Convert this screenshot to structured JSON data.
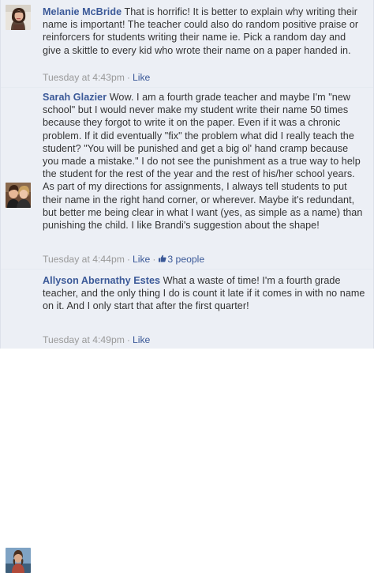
{
  "comments": [
    {
      "author": "Melanie McBride",
      "text": "That is horrific! It is better to explain why writing their name is important! The teacher could also do random positive praise or reinforcers for students writing their name ie. Pick a random day and give a skittle to every kid who wrote their name on a paper handed in.",
      "timestamp": "Tuesday at 4:43pm",
      "separator": "·",
      "like_label": "Like"
    },
    {
      "author": "Sarah Glazier",
      "text": "Wow. I am a fourth grade teacher and maybe I'm \"new school\" but I would never make my student write their name 50 times because they forgot to write it on the paper. Even if it was a chronic problem. If it did eventually \"fix\" the problem what did I really teach the student? \"You will be punished and get a big ol' hand cramp because you made a mistake.\" I do not see the punishment as a true way to help the student for the rest of the year and the rest of his/her school years. As part of my directions for assignments, I always tell students to put their name in the right hand corner, or wherever. Maybe it's redundant, but better me being clear in what I want (yes, as simple as a name) than punishing the child. I like Brandi's suggestion about the shape!",
      "timestamp": "Tuesday at 4:44pm",
      "separator": "·",
      "like_label": "Like",
      "likes_count": "3 people",
      "thumb_icon": "thumbs-up"
    },
    {
      "author": "Allyson Abernathy Estes",
      "text": "What a waste of time! I'm a fourth grade teacher, and the only thing I do is count it late if it comes in with no name on it. And I only start that after the first quarter!",
      "timestamp": "Tuesday at 4:49pm",
      "separator": "·",
      "like_label": "Like"
    }
  ],
  "colors": {
    "background": "#eceff5",
    "link": "#3b5998",
    "text": "#333333",
    "meta": "#999999"
  }
}
